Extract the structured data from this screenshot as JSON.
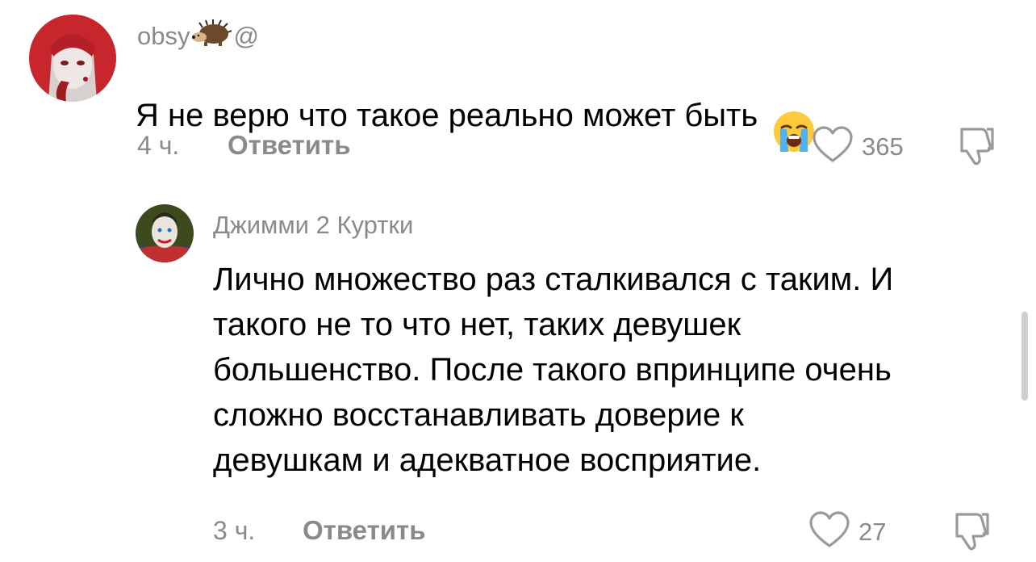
{
  "comments": [
    {
      "username": "obsy",
      "username_suffix": "@",
      "username_emoji": "hedgehog-icon",
      "text": "Я не верю что такое реально может быть",
      "text_emoji": "loudly-crying-face-icon",
      "time": "4 ч.",
      "reply_label": "Ответить",
      "likes": "365"
    },
    {
      "username": "Джимми 2 Куртки",
      "text": "Лично множество раз сталкивался с таким. И\nтакого не то что нет, таких девушек\nбольшенство. После такого впринципе очень\nсложно восстанавливать доверие к\nдевушкам и адекватное восприятие.",
      "time": "3 ч.",
      "reply_label": "Ответить",
      "likes": "27"
    }
  ],
  "colors": {
    "muted_text": "#8a8a8a",
    "body_text": "#000000",
    "background": "#ffffff"
  }
}
